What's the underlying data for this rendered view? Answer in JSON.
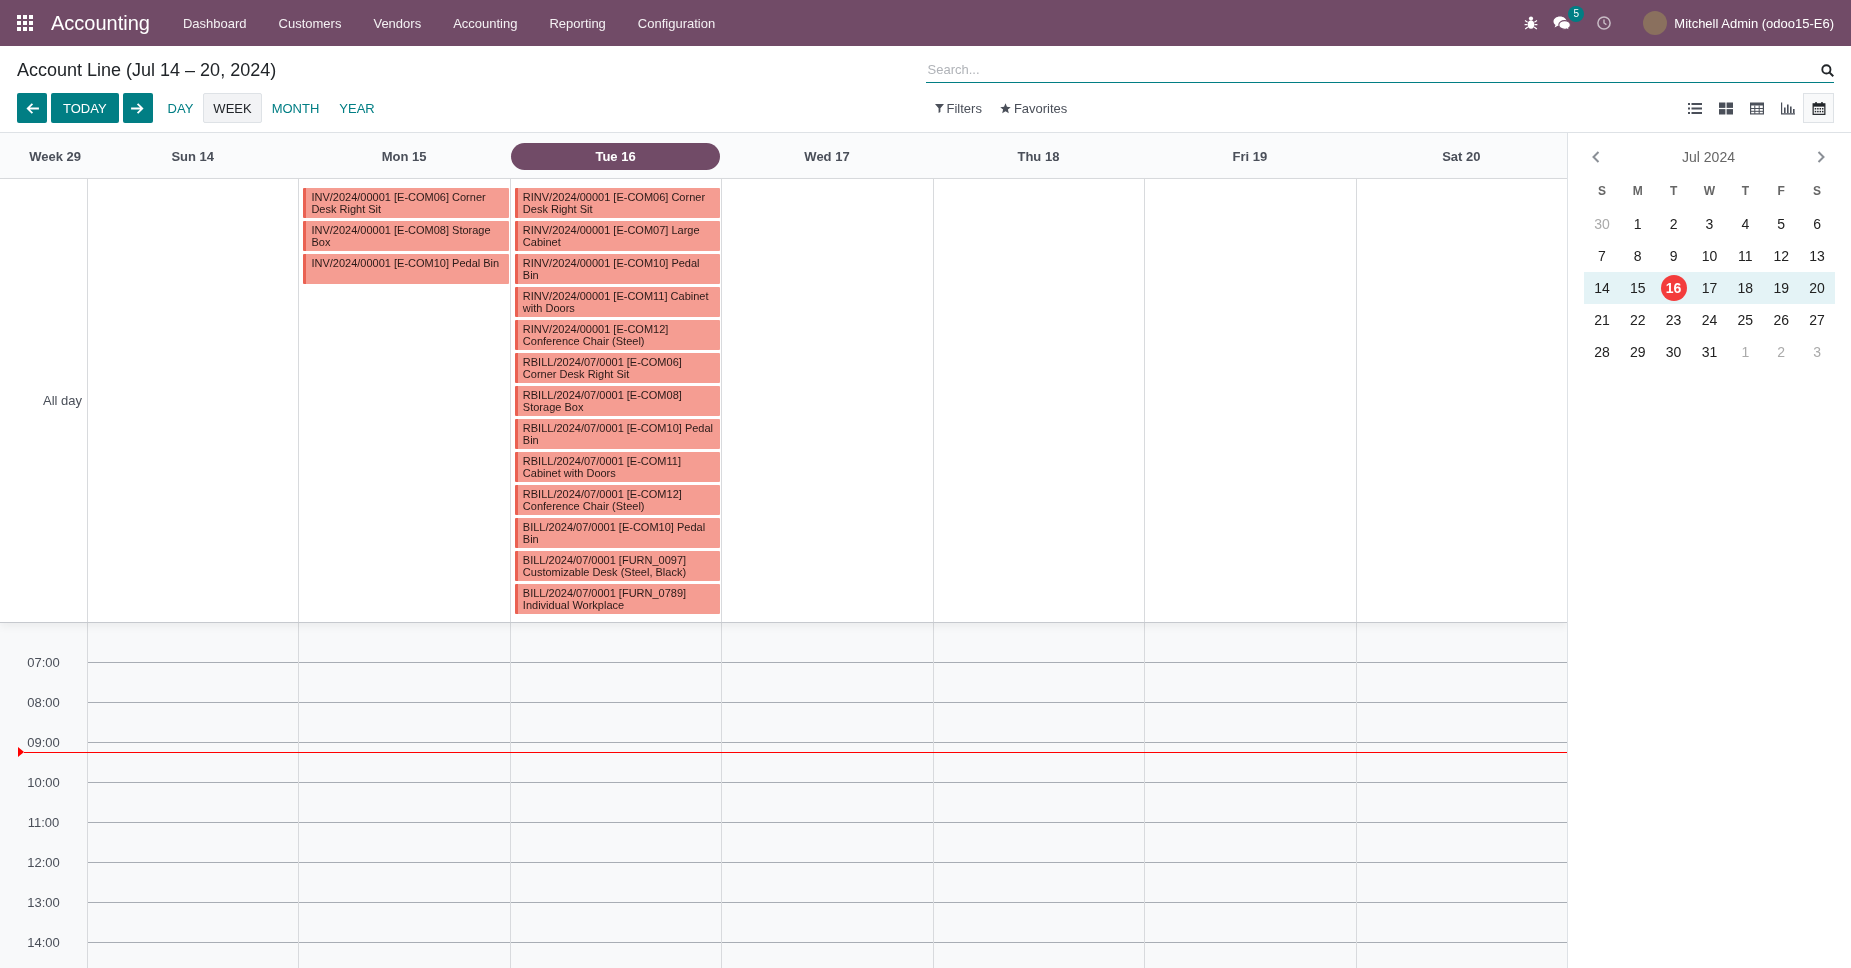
{
  "navbar": {
    "brand": "Accounting",
    "menu": [
      "Dashboard",
      "Customers",
      "Vendors",
      "Accounting",
      "Reporting",
      "Configuration"
    ],
    "messages_badge": "5",
    "user": "Mitchell Admin (odoo15-E6)"
  },
  "control_panel": {
    "title": "Account Line (Jul 14 – 20, 2024)",
    "today_button": "TODAY",
    "scales": [
      {
        "label": "DAY",
        "selected": false
      },
      {
        "label": "WEEK",
        "selected": true
      },
      {
        "label": "MONTH",
        "selected": false
      },
      {
        "label": "YEAR",
        "selected": false
      }
    ],
    "search": {
      "placeholder": "Search..."
    },
    "filters": "Filters",
    "favorites": "Favorites",
    "views": [
      {
        "kind": "list",
        "selected": false
      },
      {
        "kind": "kanban",
        "selected": false
      },
      {
        "kind": "pivot",
        "selected": false
      },
      {
        "kind": "graph",
        "selected": false
      },
      {
        "kind": "calendar",
        "selected": true
      }
    ]
  },
  "calendar": {
    "week_label": "Week 29",
    "all_day_label": "All day",
    "days": [
      {
        "label": "Sun 14",
        "today": false
      },
      {
        "label": "Mon 15",
        "today": false,
        "events": [
          "INV/2024/00001 [E-COM06] Corner Desk Right Sit",
          "INV/2024/00001 [E-COM08] Storage Box",
          "INV/2024/00001 [E-COM10] Pedal Bin"
        ]
      },
      {
        "label": "Tue 16",
        "today": true,
        "events": [
          "RINV/2024/00001 [E-COM06] Corner Desk Right Sit",
          "RINV/2024/00001 [E-COM07] Large Cabinet",
          "RINV/2024/00001 [E-COM10] Pedal Bin",
          "RINV/2024/00001 [E-COM11] Cabinet with Doors",
          "RINV/2024/00001 [E-COM12] Conference Chair (Steel)",
          "RBILL/2024/07/0001 [E-COM06] Corner Desk Right Sit",
          "RBILL/2024/07/0001 [E-COM08] Storage Box",
          "RBILL/2024/07/0001 [E-COM10] Pedal Bin",
          "RBILL/2024/07/0001 [E-COM11] Cabinet with Doors",
          "RBILL/2024/07/0001 [E-COM12] Conference Chair (Steel)",
          "BILL/2024/07/0001 [E-COM10] Pedal Bin",
          "BILL/2024/07/0001 [FURN_0097] Customizable Desk (Steel, Black)",
          "BILL/2024/07/0001 [FURN_0789] Individual Workplace"
        ]
      },
      {
        "label": "Wed 17",
        "today": false
      },
      {
        "label": "Thu 18",
        "today": false
      },
      {
        "label": "Fri 19",
        "today": false
      },
      {
        "label": "Sat 20",
        "today": false
      }
    ],
    "hours": [
      "07:00",
      "08:00",
      "09:00",
      "10:00",
      "11:00",
      "12:00",
      "13:00",
      "14:00"
    ]
  },
  "mini_calendar": {
    "month": "Jul 2024",
    "weekdays": [
      "S",
      "M",
      "T",
      "W",
      "T",
      "F",
      "S"
    ],
    "weeks": [
      {
        "selected": false,
        "days": [
          {
            "label": "30",
            "other_month": true,
            "today": false
          },
          {
            "label": "1",
            "other_month": false,
            "today": false
          },
          {
            "label": "2",
            "other_month": false,
            "today": false
          },
          {
            "label": "3",
            "other_month": false,
            "today": false
          },
          {
            "label": "4",
            "other_month": false,
            "today": false
          },
          {
            "label": "5",
            "other_month": false,
            "today": false
          },
          {
            "label": "6",
            "other_month": false,
            "today": false
          }
        ]
      },
      {
        "selected": false,
        "days": [
          {
            "label": "7",
            "other_month": false,
            "today": false
          },
          {
            "label": "8",
            "other_month": false,
            "today": false
          },
          {
            "label": "9",
            "other_month": false,
            "today": false
          },
          {
            "label": "10",
            "other_month": false,
            "today": false
          },
          {
            "label": "11",
            "other_month": false,
            "today": false
          },
          {
            "label": "12",
            "other_month": false,
            "today": false
          },
          {
            "label": "13",
            "other_month": false,
            "today": false
          }
        ]
      },
      {
        "selected": true,
        "days": [
          {
            "label": "14",
            "other_month": false,
            "today": false
          },
          {
            "label": "15",
            "other_month": false,
            "today": false
          },
          {
            "label": "16",
            "other_month": false,
            "today": true
          },
          {
            "label": "17",
            "other_month": false,
            "today": false
          },
          {
            "label": "18",
            "other_month": false,
            "today": false
          },
          {
            "label": "19",
            "other_month": false,
            "today": false
          },
          {
            "label": "20",
            "other_month": false,
            "today": false
          }
        ]
      },
      {
        "selected": false,
        "days": [
          {
            "label": "21",
            "other_month": false,
            "today": false
          },
          {
            "label": "22",
            "other_month": false,
            "today": false
          },
          {
            "label": "23",
            "other_month": false,
            "today": false
          },
          {
            "label": "24",
            "other_month": false,
            "today": false
          },
          {
            "label": "25",
            "other_month": false,
            "today": false
          },
          {
            "label": "26",
            "other_month": false,
            "today": false
          },
          {
            "label": "27",
            "other_month": false,
            "today": false
          }
        ]
      },
      {
        "selected": false,
        "days": [
          {
            "label": "28",
            "other_month": false,
            "today": false
          },
          {
            "label": "29",
            "other_month": false,
            "today": false
          },
          {
            "label": "30",
            "other_month": false,
            "today": false
          },
          {
            "label": "31",
            "other_month": false,
            "today": false
          },
          {
            "label": "1",
            "other_month": true,
            "today": false
          },
          {
            "label": "2",
            "other_month": true,
            "today": false
          },
          {
            "label": "3",
            "other_month": true,
            "today": false
          }
        ]
      }
    ]
  }
}
